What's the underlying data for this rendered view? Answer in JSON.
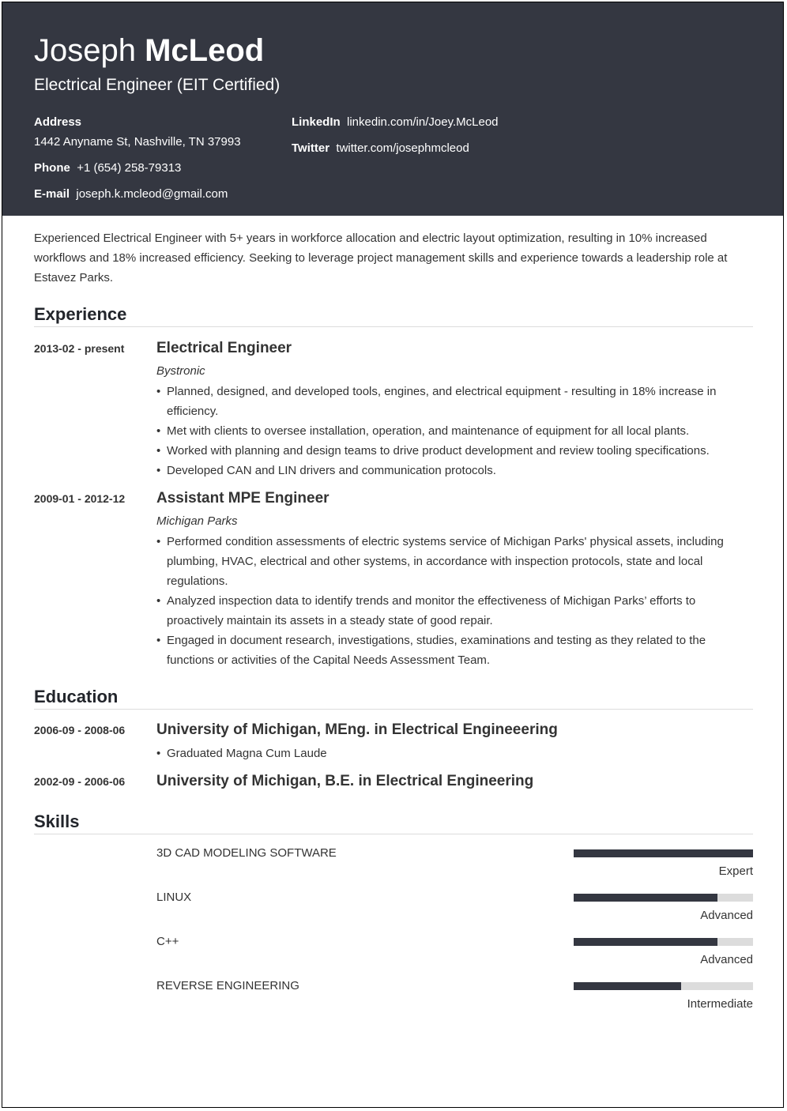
{
  "header": {
    "first_name": "Joseph",
    "last_name": "McLeod",
    "headline": "Electrical Engineer (EIT Certified)",
    "colors": {
      "header_bg": "#343741",
      "bar_fill": "#343741",
      "bar_track": "#dcdcdc"
    },
    "contact": {
      "address_label": "Address",
      "address_value": "1442 Anyname St, Nashville, TN 37993",
      "phone_label": "Phone",
      "phone_value": "+1 (654) 258-79313",
      "email_label": "E-mail",
      "email_value": "joseph.k.mcleod@gmail.com",
      "linkedin_label": "LinkedIn",
      "linkedin_value": "linkedin.com/in/Joey.McLeod",
      "twitter_label": "Twitter",
      "twitter_value": "twitter.com/josephmcleod"
    }
  },
  "summary": "Experienced Electrical Engineer with 5+ years in workforce allocation and electric layout optimization, resulting in 10% increased workflows and 18% increased efficiency. Seeking to leverage project management skills and experience towards a leadership role at Estavez Parks.",
  "experience": {
    "title": "Experience",
    "items": [
      {
        "date": "2013-02 - present",
        "role": "Electrical Engineer",
        "company": "Bystronic",
        "bullets": [
          "Planned, designed, and developed tools, engines, and electrical equipment - resulting in 18% increase in efficiency.",
          "Met with clients to oversee installation, operation, and maintenance of equipment for all local plants.",
          "Worked with planning and design teams to drive product development and review tooling specifications.",
          "Developed CAN and LIN drivers and communication protocols."
        ]
      },
      {
        "date": "2009-01 - 2012-12",
        "role": "Assistant MPE Engineer",
        "company": "Michigan Parks",
        "bullets": [
          "Performed condition assessments of electric systems service of Michigan Parks' physical assets, including plumbing, HVAC, electrical and other systems, in accordance with inspection protocols, state and local regulations.",
          "Analyzed inspection data to identify trends and monitor the effectiveness of Michigan Parks’ efforts to proactively maintain its assets in a steady state of good repair.",
          "Engaged in document research, investigations, studies, examinations and testing as they related to the functions or activities of the Capital Needs Assessment Team."
        ]
      }
    ]
  },
  "education": {
    "title": "Education",
    "items": [
      {
        "date": "2006-09 - 2008-06",
        "degree": "University of Michigan, MEng. in Electrical Engineeering",
        "bullets": [
          "Graduated Magna Cum Laude"
        ]
      },
      {
        "date": "2002-09 - 2006-06",
        "degree": "University of Michigan, B.E. in Electrical Engineering",
        "bullets": []
      }
    ]
  },
  "skills": {
    "title": "Skills",
    "items": [
      {
        "name": "3D CAD MODELING SOFTWARE",
        "level": "Expert",
        "fraction": 1.0
      },
      {
        "name": "LINUX",
        "level": "Advanced",
        "fraction": 0.8
      },
      {
        "name": "C++",
        "level": "Advanced",
        "fraction": 0.8
      },
      {
        "name": "REVERSE ENGINEERING",
        "level": "Intermediate",
        "fraction": 0.6
      }
    ]
  }
}
